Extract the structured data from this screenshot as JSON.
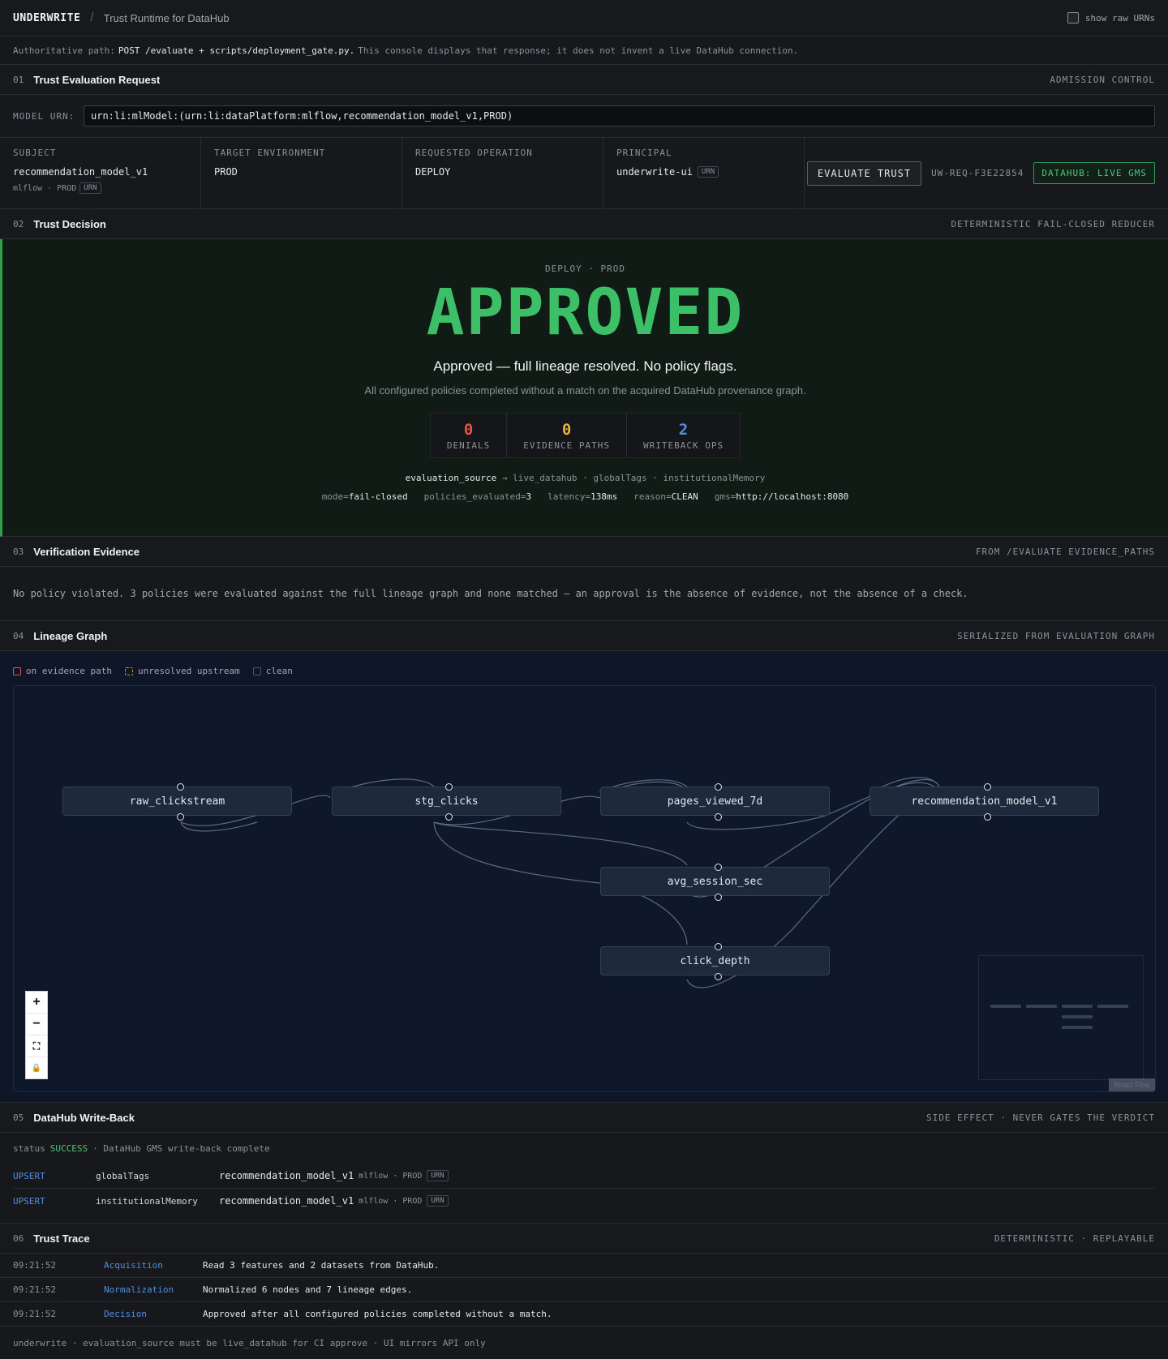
{
  "topbar": {
    "brand": "UNDERWRITE",
    "separator": "/",
    "subtitle": "Trust Runtime for DataHub",
    "raw_urns_label": "show raw URNs"
  },
  "authbar": {
    "prefix": "Authoritative path:",
    "path": "POST /evaluate + scripts/deployment_gate.py.",
    "suffix": "This console displays that response; it does not invent a live DataHub connection."
  },
  "sections": {
    "request": {
      "num": "01",
      "title": "Trust Evaluation Request",
      "right": "ADMISSION CONTROL"
    },
    "decision": {
      "num": "02",
      "title": "Trust Decision",
      "right": "DETERMINISTIC FAIL-CLOSED REDUCER"
    },
    "evidence": {
      "num": "03",
      "title": "Verification Evidence",
      "right": "FROM /EVALUATE EVIDENCE_PATHS"
    },
    "lineage": {
      "num": "04",
      "title": "Lineage Graph",
      "right": "SERIALIZED FROM EVALUATION GRAPH"
    },
    "writeback": {
      "num": "05",
      "title": "DataHub Write-Back",
      "right": "SIDE EFFECT · NEVER GATES THE VERDICT"
    },
    "trace": {
      "num": "06",
      "title": "Trust Trace",
      "right": "DETERMINISTIC · REPLAYABLE"
    }
  },
  "request": {
    "urn_label": "MODEL URN:",
    "urn_value": "urn:li:mlModel:(urn:li:dataPlatform:mlflow,recommendation_model_v1,PROD)",
    "subject_label": "SUBJECT",
    "subject_value": "recommendation_model_v1",
    "subject_meta": "mlflow · PROD",
    "urn_tag": "URN",
    "env_label": "TARGET ENVIRONMENT",
    "env_value": "PROD",
    "op_label": "REQUESTED OPERATION",
    "op_value": "DEPLOY",
    "principal_label": "PRINCIPAL",
    "principal_value": "underwrite-ui",
    "evaluate_button": "EVALUATE TRUST",
    "request_id": "UW-REQ-F3E22854",
    "live_badge": "DATAHUB: LIVE GMS",
    "accent_color": "#3cbf66"
  },
  "decision": {
    "label": "DEPLOY · PROD",
    "verdict": "APPROVED",
    "summary": "Approved — full lineage resolved. No policy flags.",
    "detail": "All configured policies completed without a match on the acquired DataHub provenance graph.",
    "stats": [
      {
        "value": "0",
        "label": "DENIALS",
        "color": "#e5534b"
      },
      {
        "value": "0",
        "label": "EVIDENCE PATHS",
        "color": "#e3b341"
      },
      {
        "value": "2",
        "label": "WRITEBACK OPS",
        "color": "#4f8fe0"
      }
    ],
    "source_key": "evaluation_source",
    "source_rest": "→ live_datahub · globalTags · institutionalMemory",
    "meta": [
      {
        "k": "mode=",
        "v": "fail-closed"
      },
      {
        "k": "policies_evaluated=",
        "v": "3"
      },
      {
        "k": "latency=",
        "v": "138ms"
      },
      {
        "k": "reason=",
        "v": "CLEAN"
      },
      {
        "k": "gms=",
        "v": "http://localhost:8080"
      }
    ]
  },
  "evidence": {
    "text": "No policy violated. 3 policies were evaluated against the full lineage graph and none matched — an approval is the absence of evidence, not the absence of a check."
  },
  "lineage": {
    "legend": [
      {
        "label": "on evidence path",
        "color": "#e5534b",
        "style": "solid"
      },
      {
        "label": "unresolved upstream",
        "color": "#d29922",
        "style": "dashed"
      },
      {
        "label": "clean",
        "color": "#4b5563",
        "style": "solid"
      }
    ],
    "nodes": [
      {
        "id": "raw",
        "label": "raw_clickstream"
      },
      {
        "id": "stg",
        "label": "stg_clicks"
      },
      {
        "id": "pv",
        "label": "pages_viewed_7d"
      },
      {
        "id": "rm",
        "label": "recommendation_model_v1"
      },
      {
        "id": "avg",
        "label": "avg_session_sec"
      },
      {
        "id": "cd",
        "label": "click_depth"
      }
    ],
    "zoom": {
      "in": "+",
      "out": "−",
      "fit": "⛶",
      "lock": "🔒"
    },
    "minimap_label": "React Flow"
  },
  "writeback": {
    "status_prefix": "status",
    "status_value": "SUCCESS",
    "status_suffix": "· DataHub GMS write-back complete",
    "ops": [
      {
        "op": "UPSERT",
        "field": "globalTags",
        "target": "recommendation_model_v1",
        "meta": "mlflow · PROD",
        "tag": "URN"
      },
      {
        "op": "UPSERT",
        "field": "institutionalMemory",
        "target": "recommendation_model_v1",
        "meta": "mlflow · PROD",
        "tag": "URN"
      }
    ]
  },
  "trace": {
    "rows": [
      {
        "time": "09:21:52",
        "phase": "Acquisition",
        "msg": "Read 3 features and 2 datasets from DataHub."
      },
      {
        "time": "09:21:52",
        "phase": "Normalization",
        "msg": "Normalized 6 nodes and 7 lineage edges."
      },
      {
        "time": "09:21:52",
        "phase": "Decision",
        "msg": "Approved after all configured policies completed without a match."
      }
    ]
  },
  "footer": {
    "text": "underwrite · evaluation_source must be live_datahub for CI approve · UI mirrors API only"
  }
}
